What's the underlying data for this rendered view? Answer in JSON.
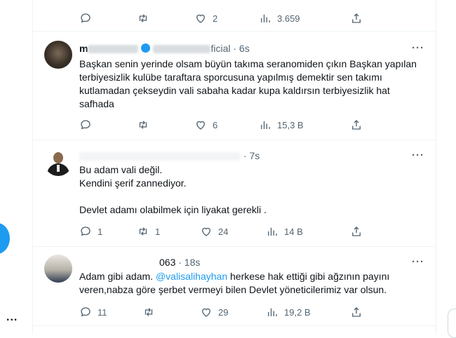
{
  "left_rail": {
    "more_label": "..."
  },
  "tweets": [
    {
      "id": "t0",
      "actions": {
        "reply": "",
        "retweet": "",
        "like": "2",
        "views": "3.659"
      }
    },
    {
      "id": "t1",
      "name": "m       ff  i  l",
      "handle": "@     ff  cial",
      "time": "· 6s",
      "text": "Başkan senin yerinde olsam büyün takıma seranomiden çıkın Başkan yapılan terbiyesizlik kulübe taraftara sporcusuna yapılmış demektir sen takımı kutlamadan çekseydin vali sabaha kadar kupa kaldırsın terbiyesizlik hat safhada",
      "actions": {
        "reply": "",
        "retweet": "",
        "like": "6",
        "views": "15,3 B"
      }
    },
    {
      "id": "t2",
      "time": "· 7s",
      "text": "Bu adam vali değil.\nKendini şerif zannediyor.\n\nDevlet adamı olabilmek için liyakat gerekli .",
      "actions": {
        "reply": "1",
        "retweet": "1",
        "like": "24",
        "views": "14 B"
      }
    },
    {
      "id": "t3",
      "handle_suffix": "063",
      "time": "· 18s",
      "text_before": "Adam gibi adam. ",
      "mention": "@valisalihayhan",
      "text_after": " herkese hak ettiği gibi ağzının payını veren,nabza göre şerbet vermeyi bilen Devlet yöneticilerimiz var olsun.",
      "actions": {
        "reply": "11",
        "retweet": "",
        "like": "29",
        "views": "19,2 B"
      }
    }
  ],
  "icons": [
    "reply-icon",
    "retweet-icon",
    "like-icon",
    "views-icon",
    "share-icon",
    "more-icon",
    "verified-icon"
  ],
  "colors": {
    "accent": "#1d9bf0",
    "muted": "#536471",
    "text": "#0f1419",
    "border": "#eff3f4"
  }
}
